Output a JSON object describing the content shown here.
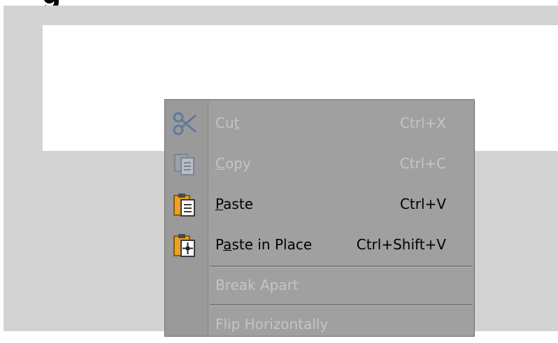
{
  "heading": {
    "text": "g"
  },
  "context_menu": {
    "items": [
      {
        "label_pre": "Cu",
        "label_accel": "t",
        "label_post": "",
        "shortcut": "Ctrl+X",
        "icon": "scissors-icon",
        "enabled": false
      },
      {
        "label_pre": "",
        "label_accel": "C",
        "label_post": "opy",
        "shortcut": "Ctrl+C",
        "icon": "copy-icon",
        "enabled": false
      },
      {
        "label_pre": "",
        "label_accel": "P",
        "label_post": "aste",
        "shortcut": "Ctrl+V",
        "icon": "clipboard-paste-icon",
        "enabled": true
      },
      {
        "label_pre": "P",
        "label_accel": "a",
        "label_post": "ste in Place",
        "shortcut": "Ctrl+Shift+V",
        "icon": "paste-in-place-icon",
        "enabled": true
      },
      {
        "label": "Break Apart",
        "enabled": false
      },
      {
        "label": "Flip Horizontally",
        "enabled": false
      }
    ]
  },
  "colors": {
    "workspace": "#d3d3d3",
    "menu_background": "#a0a0a0",
    "disabled_text": "#c4c4c4",
    "clipboard_orange": "#f0a020"
  }
}
